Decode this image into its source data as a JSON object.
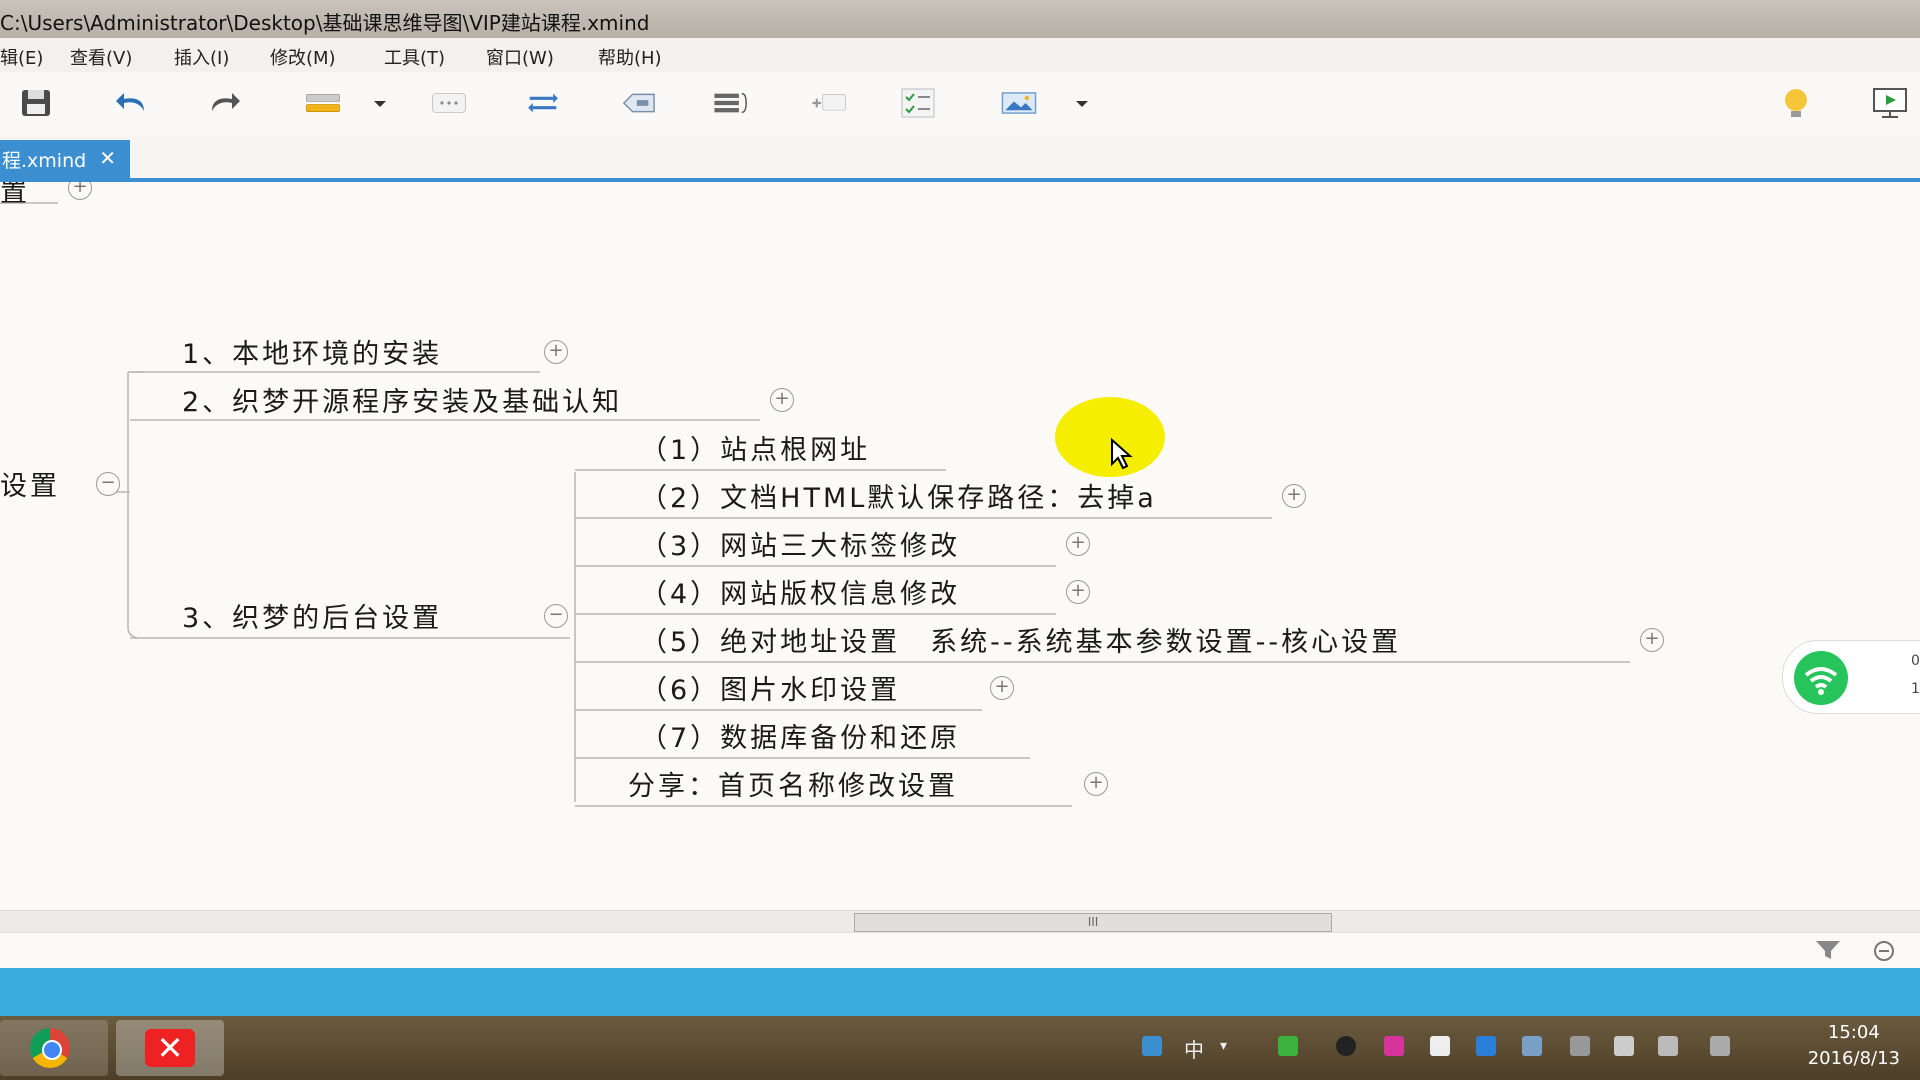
{
  "window": {
    "title": "C:\\Users\\Administrator\\Desktop\\基础课思维导图\\VIP建站课程.xmind"
  },
  "menu": [
    "辑(E)",
    "查看(V)",
    "插入(I)",
    "修改(M)",
    "工具(T)",
    "窗口(W)",
    "帮助(H)"
  ],
  "toolbar": [
    "save-icon",
    "undo-icon",
    "redo-icon",
    "topic-icon",
    "dropdown-icon",
    "more-icon",
    "relationship-icon",
    "boundary-icon",
    "summary-icon",
    "callout-icon",
    "task-icon",
    "image-icon",
    "dropdown-icon",
    "bulb-icon",
    "presentation-icon"
  ],
  "tab": {
    "label": "程.xmind",
    "close": "✕"
  },
  "mindmap": {
    "partial_top": "置",
    "root_partial": "设置",
    "branches": [
      "1、本地环境的安装",
      "2、织梦开源程序安装及基础认知",
      "3、织梦的后台设置"
    ],
    "sub": [
      "（1）站点根网址",
      "（2）文档HTML默认保存路径：去掉a",
      "（3）网站三大标签修改",
      "（4）网站版权信息修改",
      "（5）绝对地址设置　系统--系统基本参数设置--核心设置",
      "（6）图片水印设置",
      "（7）数据库备份和还原",
      "分享：首页名称修改设置"
    ],
    "expand_symbol": "+",
    "collapse_symbol": "−"
  },
  "network_widget": {
    "up": "0",
    "down": "1"
  },
  "scrollbar_grip": "III",
  "taskbar": {
    "tray_ime": "中",
    "time": "15:04",
    "date": "2016/8/13"
  },
  "colors": {
    "accent": "#3b8fd1",
    "bluebar": "#3aaddf",
    "highlight": "#f5ee00"
  }
}
